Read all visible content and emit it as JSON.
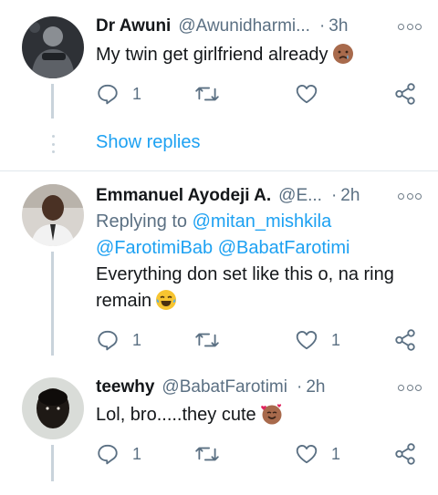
{
  "tweets": [
    {
      "name": "Dr Awuni",
      "handle": "@Awunidharmi...",
      "time": "3h",
      "text": "My twin get girlfriend already",
      "emoji": "crying-face-emoji",
      "reply_count": "1",
      "retweet_count": "",
      "like_count": ""
    },
    {
      "name": "Emmanuel Ayodeji A.",
      "handle": "@E...",
      "time": "2h",
      "replying_to_label": "Replying to",
      "replying_to": [
        "@mitan_mishkila",
        "@FarotimiBab",
        "@BabatFarotimi"
      ],
      "text_line1": "Everything don set like this o, na ring",
      "text_line2": "remain",
      "emoji": "tears-of-joy-emoji",
      "reply_count": "1",
      "retweet_count": "",
      "like_count": "1"
    },
    {
      "name": "teewhy",
      "handle": "@BabatFarotimi",
      "time": "2h",
      "text": "Lol, bro.....they cute",
      "emoji": "smiling-face-with-hearts-emoji",
      "reply_count": "1",
      "retweet_count": "",
      "like_count": "1"
    }
  ],
  "show_replies_label": "Show replies",
  "separator": "·",
  "colors": {
    "link": "#1da1f2",
    "secondary_text": "#5b7083",
    "primary_text": "#14171a",
    "icon": "#5b7083",
    "divider": "#e1e8ed"
  }
}
